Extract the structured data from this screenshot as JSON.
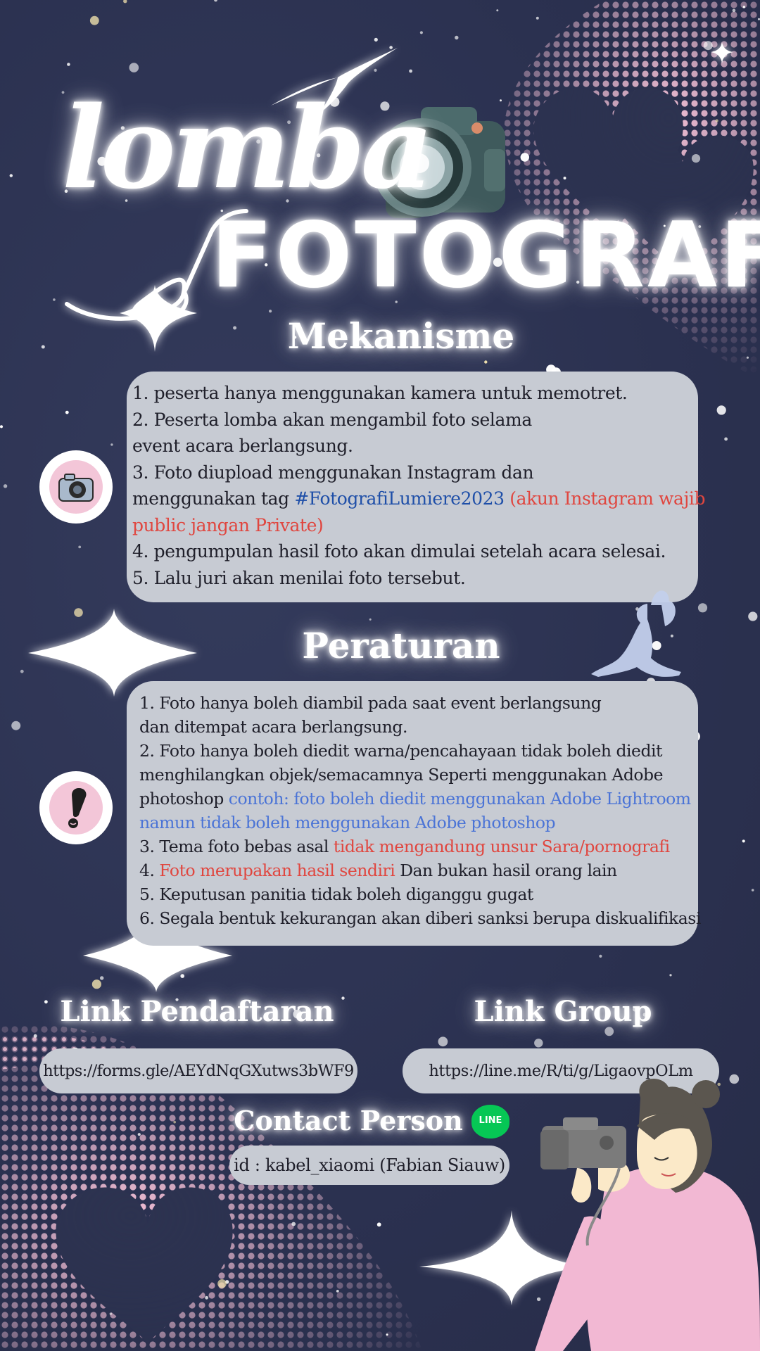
{
  "title": {
    "line1": "lomba",
    "line2": "FOTOGRAFI"
  },
  "mekanisme": {
    "heading": "Mekanisme",
    "items": [
      "1. peserta hanya menggunakan kamera untuk memotret.",
      "2. Peserta lomba akan mengambil foto selama",
      "event acara berlangsung.",
      "3. Foto diupload menggunakan Instagram dan",
      "menggunakan tag ",
      "#FotografiLumiere2023",
      " (akun Instagram wajib",
      "public jangan Private)",
      "4. pengumpulan hasil foto akan dimulai setelah acara selesai.",
      "5. Lalu juri akan menilai foto tersebut."
    ]
  },
  "peraturan": {
    "heading": "Peraturan",
    "items": [
      "1. Foto hanya boleh diambil pada saat event berlangsung",
      "dan ditempat acara berlangsung.",
      "2. Foto hanya boleh diedit warna/pencahayaan tidak boleh diedit",
      "menghilangkan objek/semacamnya Seperti menggunakan Adobe",
      "photoshop ",
      "contoh: foto boleh diedit menggunakan Adobe Lightroom",
      "namun tidak boleh menggunakan Adobe photoshop",
      "3. Tema foto bebas asal ",
      "tidak mengandung unsur Sara/pornografi",
      "4. ",
      "Foto merupakan hasil sendiri",
      " Dan bukan hasil orang lain",
      "5. Keputusan panitia tidak boleh diganggu gugat",
      "6. Segala bentuk kekurangan akan diberi sanksi berupa diskualifikasi"
    ]
  },
  "links": {
    "pendaftaran_heading": "Link Pendaftaran",
    "pendaftaran_url": "https://forms.gle/AEYdNqGXutws3bWF9",
    "group_heading": "Link Group",
    "group_url": "https://line.me/R/ti/g/LigaovpOLm"
  },
  "contact": {
    "heading": "Contact Person",
    "line_badge": "LINE",
    "id_text": "id : kabel_xiaomi (Fabian Siauw)"
  },
  "colors": {
    "background": "#2d3350",
    "panel": "#c7cbd3",
    "pink": "#f2bfd5",
    "tag_blue": "#1f4fa8",
    "note_blue": "#4b74d6",
    "warning_red": "#e0463f",
    "line_green": "#06c755"
  },
  "icons": [
    "camera-icon",
    "exclamation-icon",
    "line-logo-icon",
    "sparkle-icon",
    "fairy-silhouette",
    "photographer-illustration",
    "camera-illustration"
  ]
}
